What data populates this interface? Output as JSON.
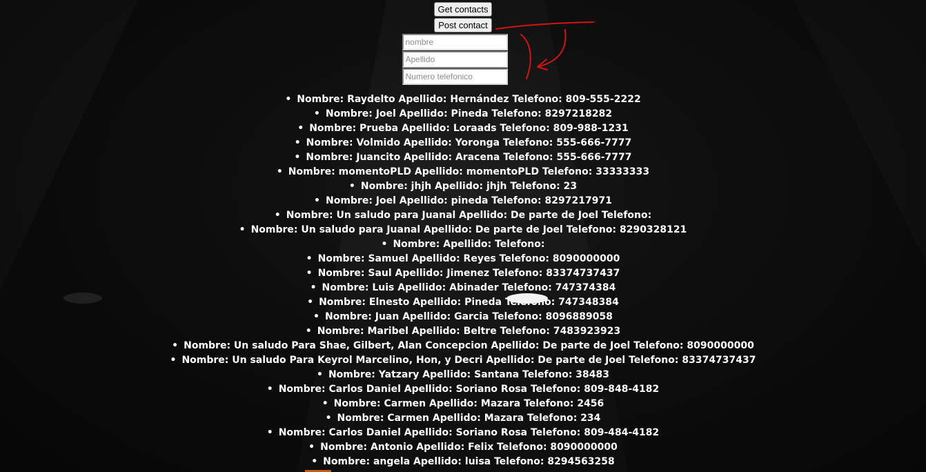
{
  "buttons": {
    "get_contacts": "Get contacts",
    "post_contact": "Post contact"
  },
  "form": {
    "nombre_placeholder": "nombre",
    "apellido_placeholder": "Apellido",
    "telefono_placeholder": "Numero telefonico"
  },
  "contacts": [
    "Nombre: Raydelto Apellido: Hernández Telefono: 809-555-2222",
    "Nombre: Joel Apellido: Pineda Telefono: 8297218282",
    "Nombre: Prueba Apellido: Loraads Telefono: 809-988-1231",
    "Nombre: Volmido Apellido: Yoronga Telefono: 555-666-7777",
    "Nombre: Juancito Apellido: Aracena Telefono: 555-666-7777",
    "Nombre: momentoPLD Apellido: momentoPLD Telefono: 33333333",
    "Nombre: jhjh Apellido: jhjh Telefono: 23",
    "Nombre: Joel Apellido: pineda Telefono: 8297217971",
    "Nombre: Un saludo para Juanal Apellido: De parte de Joel Telefono:",
    "Nombre: Un saludo para Juanal Apellido: De parte de Joel Telefono: 8290328121",
    "Nombre: Apellido: Telefono:",
    "Nombre: Samuel Apellido: Reyes Telefono: 8090000000",
    "Nombre: Saul Apellido: Jimenez Telefono: 83374737437",
    "Nombre: Luis Apellido: Abinader Telefono: 747374384",
    "Nombre: Elnesto Apellido: Pineda Telefono: 747348384",
    "Nombre: Juan Apellido: Garcia Telefono: 8096889058",
    "Nombre: Maribel Apellido: Beltre Telefono: 7483923923",
    "Nombre: Un saludo Para Shae, Gilbert, Alan Concepcion Apellido: De parte de Joel Telefono: 8090000000",
    "Nombre: Un saludo Para Keyrol Marcelino, Hon, y Decri Apellido: De parte de Joel Telefono: 83374737437",
    "Nombre: Yatzary Apellido: Santana Telefono: 38483",
    "Nombre: Carlos Daniel Apellido: Soriano Rosa Telefono: 809-848-4182",
    "Nombre: Carmen Apellido: Mazara Telefono: 2456",
    "Nombre: Carmen Apellido: Mazara Telefono: 234",
    "Nombre: Carlos Daniel Apellido: Soriano Rosa Telefono: 809-484-4182",
    "Nombre: Antonio Apellido: Felix Telefono: 8090000000",
    "Nombre: angela Apellido: luisa Telefono: 8294563258"
  ],
  "colors": {
    "annotation": "#d41414",
    "text": "#ffffff",
    "background": "#121212"
  },
  "icons": {
    "bullet": "bullet-icon",
    "annotation": "red-arrow-icon"
  }
}
